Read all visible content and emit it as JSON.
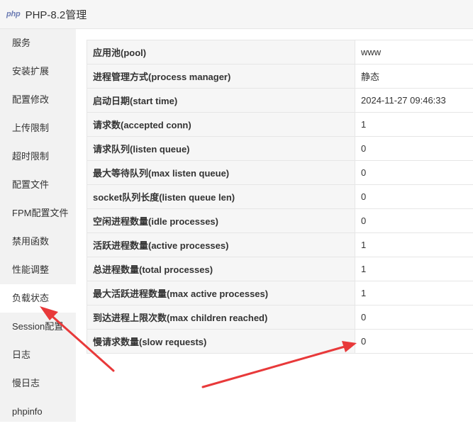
{
  "header": {
    "logo": "php",
    "title": "PHP-8.2管理"
  },
  "sidebar": {
    "items": [
      {
        "label": "服务"
      },
      {
        "label": "安装扩展"
      },
      {
        "label": "配置修改"
      },
      {
        "label": "上传限制"
      },
      {
        "label": "超时限制"
      },
      {
        "label": "配置文件"
      },
      {
        "label": "FPM配置文件"
      },
      {
        "label": "禁用函数"
      },
      {
        "label": "性能调整"
      },
      {
        "label": "负载状态",
        "active": true
      },
      {
        "label": "Session配置"
      },
      {
        "label": "日志"
      },
      {
        "label": "慢日志"
      },
      {
        "label": "phpinfo"
      }
    ]
  },
  "status_table": {
    "rows": [
      {
        "key": "应用池(pool)",
        "value": "www"
      },
      {
        "key": "进程管理方式(process manager)",
        "value": "静态"
      },
      {
        "key": "启动日期(start time)",
        "value": "2024-11-27 09:46:33"
      },
      {
        "key": "请求数(accepted conn)",
        "value": "1"
      },
      {
        "key": "请求队列(listen queue)",
        "value": "0"
      },
      {
        "key": "最大等待队列(max listen queue)",
        "value": "0"
      },
      {
        "key": "socket队列长度(listen queue len)",
        "value": "0"
      },
      {
        "key": "空闲进程数量(idle processes)",
        "value": "0"
      },
      {
        "key": "活跃进程数量(active processes)",
        "value": "1"
      },
      {
        "key": "总进程数量(total processes)",
        "value": "1"
      },
      {
        "key": "最大活跃进程数量(max active processes)",
        "value": "1"
      },
      {
        "key": "到达进程上限次数(max children reached)",
        "value": "0"
      },
      {
        "key": "慢请求数量(slow requests)",
        "value": "0"
      }
    ]
  },
  "colors": {
    "annotation_arrow": "#e8393a",
    "logo": "#6b7bb3"
  }
}
